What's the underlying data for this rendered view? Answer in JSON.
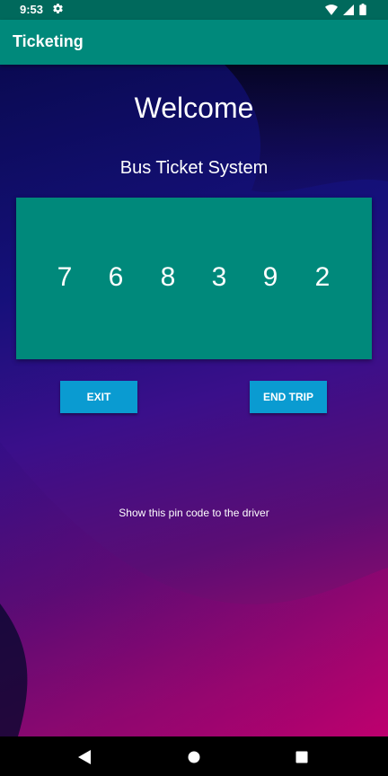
{
  "status_bar": {
    "time": "9:53",
    "icons": [
      "settings-gear-icon",
      "wifi-icon",
      "signal-icon",
      "battery-icon"
    ]
  },
  "app_bar": {
    "title": "Ticketing",
    "color": "#00897b"
  },
  "main": {
    "welcome": "Welcome",
    "subtitle": "Bus Ticket System",
    "pin_digits": [
      "7",
      "6",
      "8",
      "3",
      "9",
      "2"
    ],
    "hint": "Show this pin code to the driver",
    "pin_card_color": "#00897b"
  },
  "buttons": {
    "exit_label": "EXIT",
    "end_trip_label": "END TRIP",
    "color": "#0a9bd1"
  },
  "nav_bar": {
    "icons": [
      "back-icon",
      "home-icon",
      "recents-icon"
    ]
  }
}
